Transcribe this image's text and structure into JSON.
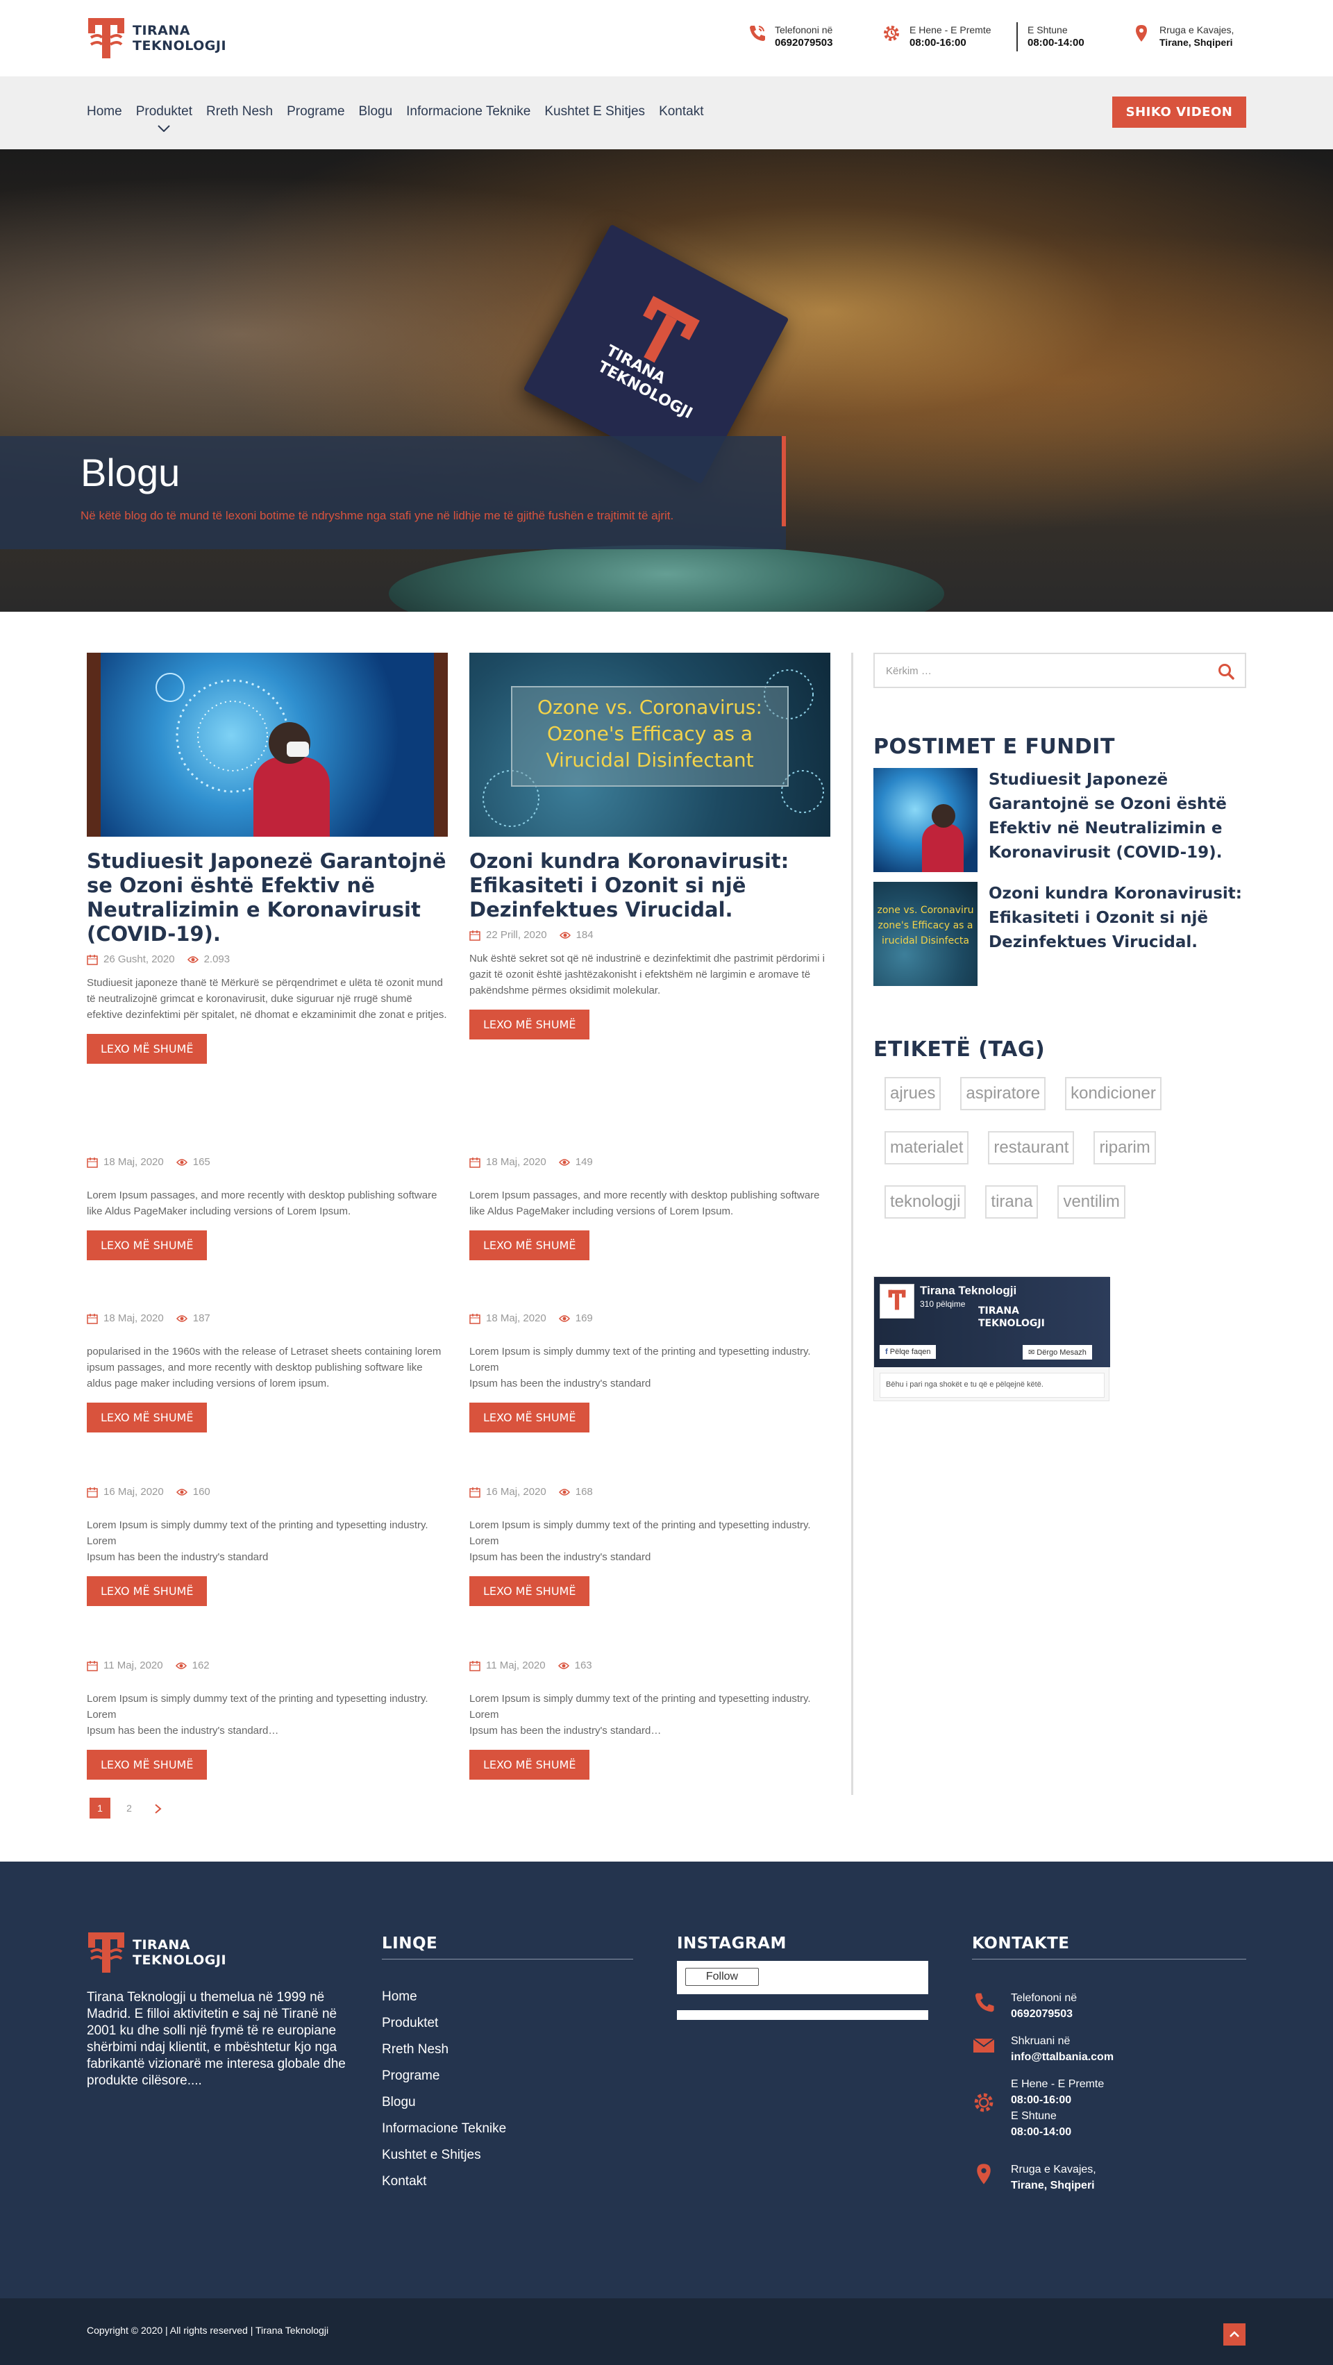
{
  "brand": {
    "name_line1": "TIRANA",
    "name_line2": "TEKNOLOGJI",
    "accent": "#d9533d",
    "navy": "#24344e"
  },
  "header": {
    "phone_label": "Telefononi në",
    "phone_value": "0692079503",
    "hours1_label": "E Hene - E Premte",
    "hours1_value": "08:00-16:00",
    "hours2_label": "E Shtune",
    "hours2_value": "08:00-14:00",
    "address_line1": "Rruga e Kavajes,",
    "address_line2": "Tirane, Shqiperi"
  },
  "nav": {
    "items": [
      "Home",
      "Produktet",
      "Rreth Nesh",
      "Programe",
      "Blogu",
      "Informacione Teknike",
      "Kushtet E Shitjes",
      "Kontakt"
    ],
    "video_button": "SHIKO VIDEON"
  },
  "hero": {
    "title": "Blogu",
    "subtitle": "Në këtë blog do të mund të lexoni botime të ndryshme nga stafi yne në lidhje me të gjithë fushën e trajtimit të ajrit.",
    "card_text_line1": "TIRANA",
    "card_text_line2": "TEKNOLOGJI"
  },
  "posts": [
    {
      "title": "Studiuesit Japonezë Garantojnë se Ozoni është Efektiv në Neutralizimin e Koronavirusit (COVID-19).",
      "date": "26 Gusht, 2020",
      "views": "2.093",
      "excerpt": "Studiuesit japoneze thanë të Mërkurë se përqendrimet e ulëta të ozonit mund të neutralizojnë grimcat e koronavirusit, duke siguruar një rrugë shumë efektive dezinfektimi për spitalet, në dhomat e ekzaminimit dhe zonat e pritjes.",
      "button": "LEXO MË SHUMË"
    },
    {
      "title": "Ozoni kundra Koronavirusit: Efikasiteti i Ozonit si një Dezinfektues Virucidal.",
      "date": "22 Prill, 2020",
      "views": "184",
      "excerpt": "Nuk është sekret sot që në industrinë e dezinfektimit dhe pastrimit përdorimi i gazit të ozonit është jashtëzakonisht i efektshëm në largimin e aromave të pakëndshme përmes oksidimit molekular.",
      "button": "LEXO MË SHUMË",
      "image_line1": "Ozone vs. Coronavirus:",
      "image_line2": "Ozone's Efficacy as a",
      "image_line3": "Virucidal Disinfectant"
    }
  ],
  "small_posts": [
    {
      "date": "18 Maj, 2020",
      "views": "165",
      "excerpt": "Lorem Ipsum passages, and more recently with desktop publishing software like Aldus PageMaker including versions of Lorem Ipsum.",
      "button": "LEXO MË SHUMË"
    },
    {
      "date": "18 Maj, 2020",
      "views": "149",
      "excerpt": "Lorem Ipsum passages, and more recently with desktop publishing software like Aldus PageMaker including versions of Lorem Ipsum.",
      "button": "LEXO MË SHUMË"
    },
    {
      "date": "18 Maj, 2020",
      "views": "187",
      "excerpt": "popularised in the 1960s with the release of Letraset sheets containing lorem ipsum passages, and more recently with desktop publishing software like aldus page maker including versions of lorem ipsum.",
      "button": "LEXO MË SHUMË"
    },
    {
      "date": "18 Maj, 2020",
      "views": "169",
      "excerpt": "Lorem Ipsum is simply dummy text of the printing and typesetting industry. Lorem\nIpsum has been the industry's standard",
      "button": "LEXO MË SHUMË"
    },
    {
      "date": "16 Maj, 2020",
      "views": "160",
      "excerpt": "Lorem Ipsum is simply dummy text of the printing and typesetting industry. Lorem\nIpsum has been the industry's standard",
      "button": "LEXO MË SHUMË"
    },
    {
      "date": "16 Maj, 2020",
      "views": "168",
      "excerpt": "Lorem Ipsum is simply dummy text of the printing and typesetting industry. Lorem\nIpsum has been the industry's standard",
      "button": "LEXO MË SHUMË"
    },
    {
      "date": "11 Maj, 2020",
      "views": "162",
      "excerpt": "Lorem Ipsum is simply dummy text of the printing and typesetting industry. Lorem\nIpsum has been the industry's standard…",
      "button": "LEXO MË SHUMË"
    },
    {
      "date": "11 Maj, 2020",
      "views": "163",
      "excerpt": "Lorem Ipsum is simply dummy text of the printing and typesetting industry. Lorem\nIpsum has been the industry's standard…",
      "button": "LEXO MË SHUMË"
    }
  ],
  "pagination": {
    "current": "1",
    "next_page": "2",
    "next_icon": "chevron-right-icon"
  },
  "sidebar": {
    "search_placeholder": "Kërkim …",
    "recent_heading": "POSTIMET E FUNDIT",
    "recent": [
      {
        "title": "Studiuesit Japonezë Garantojnë se Ozoni është Efektiv në Neutralizimin e Koronavirusit (COVID-19)."
      },
      {
        "title": "Ozoni kundra Koronavirusit: Efikasiteti i Ozonit si një Dezinfektues Virucidal.",
        "image_line1": "zone vs. Coronaviru",
        "image_line2": "zone's Efficacy as a",
        "image_line3": "irucidal Disinfecta"
      }
    ],
    "tags_heading": "ETIKETË (TAG)",
    "tags": [
      "ajrues",
      "aspiratore",
      "kondicioner",
      "materialet",
      "restaurant",
      "riparim",
      "teknologji",
      "tirana",
      "ventilim"
    ],
    "fb": {
      "page_name": "Tirana Teknologji",
      "likes": "310 pëlqime",
      "like_button": "Pëlqe faqen",
      "message_button": "Dërgo Mesazh",
      "note": "Bëhu i pari nga shokët e tu që e pëlqejnë këtë."
    }
  },
  "footer": {
    "about": "Tirana Teknologji u themelua në 1999 në Madrid. E filloi aktivitetin e saj në Tiranë në 2001 ku dhe solli një frymë të re europiane shërbimi ndaj klientit, e mbështetur kjo nga fabrikantë vizionarë me interesa globale dhe produkte cilësore....",
    "links_heading": "LINQE",
    "links": [
      "Home",
      "Produktet",
      "Rreth Nesh",
      "Programe",
      "Blogu",
      "Informacione Teknike",
      "Kushtet e Shitjes",
      "Kontakt"
    ],
    "instagram_heading": "INSTAGRAM",
    "follow": "Follow",
    "contact_heading": "KONTAKTE",
    "phone_label": "Telefononi në",
    "phone_value": "0692079503",
    "email_label": "Shkruani në",
    "email_value": "info@ttalbania.com",
    "hours1_label": "E Hene - E Premte",
    "hours1_value": "08:00-16:00",
    "hours2_label": "E Shtune",
    "hours2_value": "08:00-14:00",
    "address_line1": "Rruga e Kavajes,",
    "address_line2": "Tirane, Shqiperi",
    "copyright": "Copyright © 2020 | All rights reserved | Tirana Teknologji"
  }
}
